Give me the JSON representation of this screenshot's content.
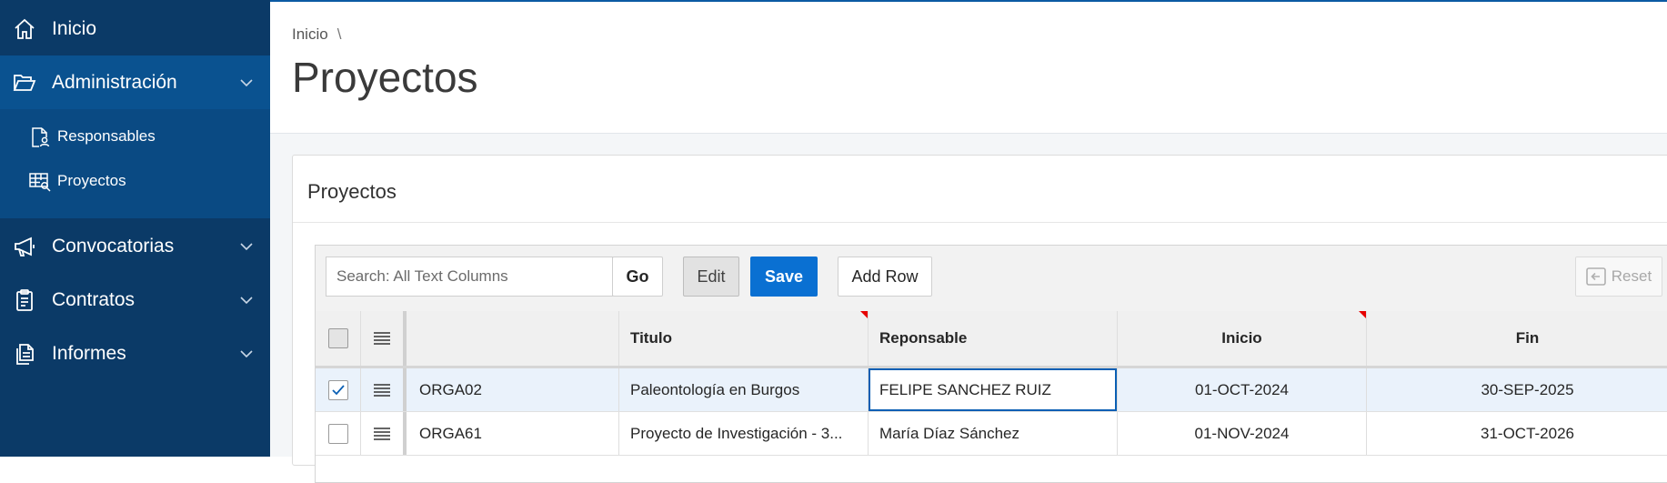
{
  "sidebar": {
    "items": [
      {
        "label": "Inicio",
        "icon": "home-icon"
      },
      {
        "label": "Administración",
        "icon": "folder-open-icon"
      },
      {
        "label": "Convocatorias",
        "icon": "megaphone-icon"
      },
      {
        "label": "Contratos",
        "icon": "clipboard-icon"
      },
      {
        "label": "Informes",
        "icon": "documents-icon"
      }
    ],
    "subitems": [
      {
        "label": "Responsables",
        "icon": "user-document-icon"
      },
      {
        "label": "Proyectos",
        "icon": "table-search-icon"
      }
    ]
  },
  "header": {
    "breadcrumb": "Inicio",
    "breadcrumb_sep": "\\",
    "title": "Proyectos"
  },
  "region": {
    "title": "Proyectos"
  },
  "toolbar": {
    "search_placeholder": "Search: All Text Columns",
    "go_label": "Go",
    "edit_label": "Edit",
    "save_label": "Save",
    "add_row_label": "Add Row",
    "reset_label": "Reset"
  },
  "grid": {
    "columns": [
      "",
      "Titulo",
      "Reponsable",
      "Inicio",
      "Fin"
    ],
    "rows": [
      {
        "selected": true,
        "code": "ORGA02",
        "titulo": "Paleontología en Burgos",
        "responsable": "FELIPE SANCHEZ RUIZ",
        "inicio": "01-OCT-2024",
        "fin": "30-SEP-2025"
      },
      {
        "selected": false,
        "code": "ORGA61",
        "titulo": "Proyecto de Investigación - 3...",
        "responsable": "María Díaz Sánchez",
        "inicio": "01-NOV-2024",
        "fin": "31-OCT-2026"
      }
    ]
  },
  "colors": {
    "sidebar": "#0b3a67",
    "sidebar_active": "#0a5290",
    "primary_button": "#0a70d2",
    "changed_marker": "#e60000"
  }
}
